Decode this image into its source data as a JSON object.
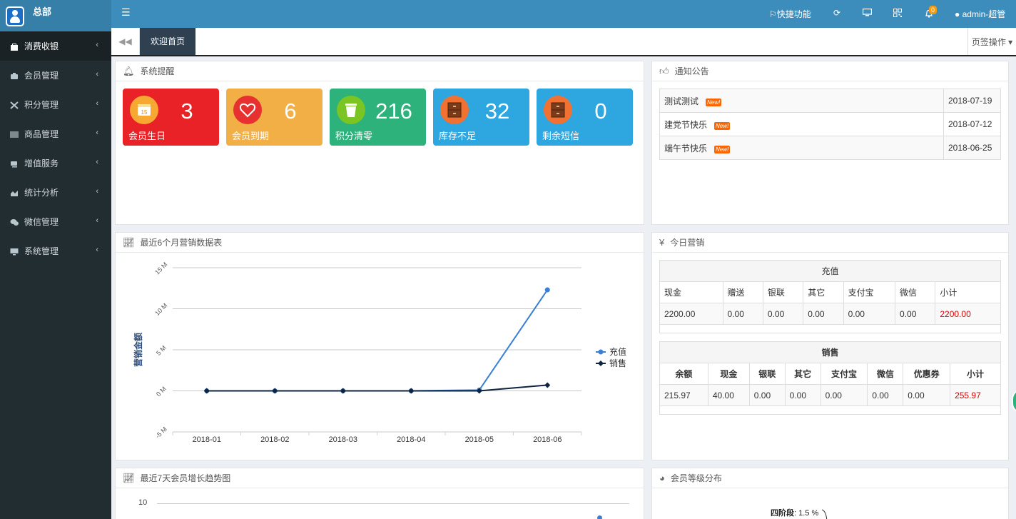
{
  "sidebar": {
    "brand": "总部",
    "items": [
      {
        "label": "消费收银",
        "icon": "bag-icon"
      },
      {
        "label": "会员管理",
        "icon": "users-icon"
      },
      {
        "label": "积分管理",
        "icon": "gift-icon"
      },
      {
        "label": "商品管理",
        "icon": "barcode-icon"
      },
      {
        "label": "增值服务",
        "icon": "car-icon"
      },
      {
        "label": "统计分析",
        "icon": "area-chart-icon"
      },
      {
        "label": "微信管理",
        "icon": "wechat-icon"
      },
      {
        "label": "系统管理",
        "icon": "monitor-icon"
      }
    ]
  },
  "topbar": {
    "quick": "快捷功能",
    "notify_count": "0",
    "user": "admin-超管"
  },
  "tabs": {
    "current": "欢迎首页",
    "ops": "页签操作"
  },
  "reminder": {
    "title": "系统提醒",
    "cards": [
      {
        "label": "会员生日",
        "value": "3",
        "color": "#e92227",
        "circle": "#f7a833",
        "icon": "calendar-icon"
      },
      {
        "label": "会员到期",
        "value": "6",
        "color": "#f2af46",
        "circle": "#e63130",
        "icon": "heart-icon"
      },
      {
        "label": "积分清零",
        "value": "216",
        "color": "#2cb27a",
        "circle": "#7ac423",
        "icon": "trash-icon"
      },
      {
        "label": "库存不足",
        "value": "32",
        "color": "#2ea7e0",
        "circle": "#f07132",
        "icon": "cabinet-icon"
      },
      {
        "label": "剩余短信",
        "value": "0",
        "color": "#2ea7e0",
        "circle": "#f07132",
        "icon": "cabinet-icon"
      }
    ]
  },
  "notice": {
    "title": "通知公告",
    "rows": [
      {
        "title": "测试测试",
        "tag": "New!",
        "date": "2018-07-19"
      },
      {
        "title": "建党节快乐",
        "tag": "New!",
        "date": "2018-07-12"
      },
      {
        "title": "端午节快乐",
        "tag": "New!",
        "date": "2018-06-25"
      }
    ]
  },
  "sales_chart": {
    "title": "最近6个月营销数据表"
  },
  "chart_data": {
    "type": "line",
    "categories": [
      "2018-01",
      "2018-02",
      "2018-03",
      "2018-04",
      "2018-05",
      "2018-06"
    ],
    "series": [
      {
        "name": "充值",
        "values": [
          0,
          0,
          0,
          0,
          0.1,
          12.3
        ],
        "color": "#3a7fd5"
      },
      {
        "name": "销售",
        "values": [
          0,
          0,
          0,
          0,
          0,
          0.7
        ],
        "color": "#0f2440"
      }
    ],
    "ylabel": "营销金额",
    "yticks": [
      "-5 M",
      "0 M",
      "5 M",
      "10 M",
      "15 M"
    ],
    "ylim": [
      -5,
      15
    ],
    "legend": "right",
    "grid": true
  },
  "today": {
    "title": "今日营销",
    "recharge": {
      "caption": "充值",
      "headers": [
        "现金",
        "赠送",
        "银联",
        "其它",
        "支付宝",
        "微信",
        "小计"
      ],
      "values": [
        "2200.00",
        "0.00",
        "0.00",
        "0.00",
        "0.00",
        "0.00",
        "2200.00"
      ]
    },
    "sales": {
      "caption": "销售",
      "headers": [
        "余额",
        "现金",
        "银联",
        "其它",
        "支付宝",
        "微信",
        "优惠券",
        "小计"
      ],
      "values": [
        "215.97",
        "40.00",
        "0.00",
        "0.00",
        "0.00",
        "0.00",
        "0.00",
        "255.97"
      ]
    }
  },
  "growth": {
    "title": "最近7天会员增长趋势图",
    "ytick": "10"
  },
  "levels": {
    "title": "会员等级分布",
    "label_name": "四阶段",
    "label_value": "1.5 %"
  }
}
